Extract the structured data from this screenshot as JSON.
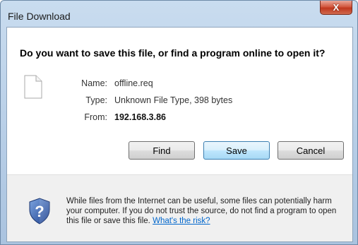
{
  "window": {
    "title": "File Download",
    "close_glyph": "X"
  },
  "dialog": {
    "question": "Do you want to save this file, or find a program online to open it?",
    "file": {
      "name_label": "Name:",
      "name_value": "offline.req",
      "type_label": "Type:",
      "type_value": "Unknown File Type, 398 bytes",
      "from_label": "From:",
      "from_value": "192.168.3.86",
      "icon": "document-icon"
    },
    "buttons": {
      "find": "Find",
      "save": "Save",
      "cancel": "Cancel"
    }
  },
  "footer": {
    "icon": "shield-question-icon",
    "warning_text": "While files from the Internet can be useful, some files can potentially harm your computer. If you do not trust the source, do not find a program to open this file or save this file.",
    "risk_link": "What's the risk?"
  },
  "colors": {
    "title_bar": "#b6cde6",
    "close_button": "#c0371d",
    "link": "#0066cc",
    "default_button_border": "#3c7fb1",
    "footer_bg": "#f0f0f0"
  }
}
